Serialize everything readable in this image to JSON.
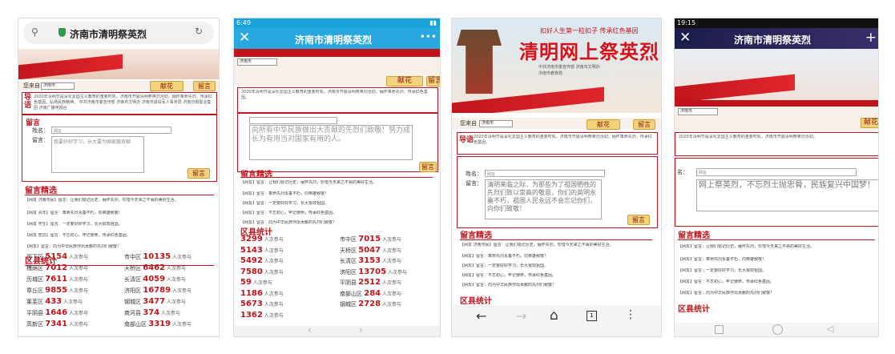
{
  "p1": {
    "address": "济南市清明祭英烈",
    "greeting": "您来自",
    "region_select": "济南市",
    "btn_offer": "献花",
    "btn_msg": "留言",
    "guide_title": "导语",
    "guide_text": "2020年清明节是深化爱国主义教育的重要时机，济南市开展清明祭英烈活动，缅怀革命先烈，传承红色基因，弘扬民族精神。",
    "guide_text2": "中共济南市委宣传部 济南市文明办 济南市退役军人事务局 济南日报报业集团 济南广播电视台",
    "msg_title": "留言",
    "name_label": "姓名：",
    "name_value": "网友",
    "msg_label": "留言：",
    "msg_placeholder": "我要好好学习，长大要为国家做贡献",
    "submit": "留言",
    "selected_title": "留言精选",
    "msgs": [
      "【网友 济南市民】留言：让我们铭记历史，缅怀先烈，珍惜今天来之不易的美好生活。",
      "【网友 青年】留言：革命先烈永垂不朽，向英雄致敬！",
      "【网友 学生】留言：一定要好好学习，长大报效祖国。",
      "【网友 党员】留言：不忘初心，牢记使命，传承红色基因。",
      "【网友】留言：向为中华民族作出贡献的先烈们致敬！"
    ],
    "stats_title": "区县统计",
    "unit": "人次参与",
    "stats": [
      {
        "name": "历下区",
        "n": "5154"
      },
      {
        "name": "市中区",
        "n": "10135"
      },
      {
        "name": "槐荫区",
        "n": "7012"
      },
      {
        "name": "天桥区",
        "n": "6462"
      },
      {
        "name": "历城区",
        "n": "7611"
      },
      {
        "name": "长清区",
        "n": "4059"
      },
      {
        "name": "章丘区",
        "n": "9855"
      },
      {
        "name": "济阳区",
        "n": "16789"
      },
      {
        "name": "莱芜区",
        "n": "433"
      },
      {
        "name": "钢城区",
        "n": "3477"
      },
      {
        "name": "平阴县",
        "n": "1646"
      },
      {
        "name": "商河县",
        "n": "374"
      },
      {
        "name": "高新区",
        "n": "7341"
      },
      {
        "name": "南部山区",
        "n": "3319"
      }
    ]
  },
  "p2": {
    "time": "6:49",
    "title": "济南市清明祭英烈",
    "region_select": "济南市",
    "btn_offer": "献花",
    "btn_msg": "留言",
    "guide_text": "2020年清明节是深化爱国主义教育的重要时机，济南市开展清明祭英烈活动，缅怀革命先烈，传承红色基因。",
    "msg_placeholder": "向所有中华民族做出大贡献的先烈们致敬！努力成长为有用当对国家有用的人。",
    "selected_title": "留言精选",
    "msgs": [
      "【网友】留言：让我们铭记历史，缅怀先烈，珍惜今天来之不易的美好生活。",
      "【网友】留言：革命先烈永垂不朽，向英雄致敬！",
      "【网友】留言：一定要好好学习，长大报效祖国。",
      "【网友】留言：不忘初心，牢记使命，传承红色基因。",
      "【网友】留言：向为中华民族作出贡献的先烈们致敬！"
    ],
    "stats_title": "区县统计",
    "unit": "人次参与",
    "stats": [
      {
        "name": "",
        "n": "3299"
      },
      {
        "name": "市中区",
        "n": "7015"
      },
      {
        "name": "",
        "n": "5143"
      },
      {
        "name": "天桥区",
        "n": "5047"
      },
      {
        "name": "",
        "n": "5492"
      },
      {
        "name": "长清区",
        "n": "3153"
      },
      {
        "name": "",
        "n": "7580"
      },
      {
        "name": "济阳区",
        "n": "13705"
      },
      {
        "name": "",
        "n": "59"
      },
      {
        "name": "平阴县",
        "n": "2512"
      },
      {
        "name": "",
        "n": "1186"
      },
      {
        "name": "南部山区",
        "n": "284"
      },
      {
        "name": "",
        "n": "5673"
      },
      {
        "name": "钢城区",
        "n": "2728"
      },
      {
        "name": "",
        "n": "1362"
      }
    ]
  },
  "p3": {
    "slogan": "扣好人生第一粒扣子 传承红色基因",
    "big_title": "清明网上祭英烈",
    "org1": "中共济南市委宣传部 济南市文明办",
    "org2": "济南市教育局",
    "greeting": "您来自",
    "region_select": "济南市",
    "btn_offer": "献花",
    "btn_msg": "留言",
    "guide_title": "导语",
    "guide_text": "2020年清明节是深化爱国主义教育的重要时机，济南市开展清明祭英烈活动，缅怀革命先烈，传承红色基因。",
    "msg_title": "留言",
    "name_label": "姓名：",
    "name_value": "网友",
    "msg_label": "留言：",
    "msg_text": "清明来临之际，为那些为了祖国牺牲的先烈们致以崇高的敬意，你们的英明永垂不朽，祖国人民永远不会忘记你们，向你们致敬！",
    "submit": "留言",
    "selected_title": "留言精选",
    "msgs": [
      "【网友 济南市民】留言：让我们铭记历史，缅怀先烈，珍惜今天来之不易的美好生活。",
      "【网友】留言：革命先烈永垂不朽，向英雄致敬！",
      "【网友】留言：一定要好好学习，长大报效祖国。",
      "【网友】留言：不忘初心，牢记使命，传承红色基因。",
      "【网友】留言：向为中华民族作出贡献的先烈们致敬！"
    ],
    "stats_title": "区县统计"
  },
  "p4": {
    "time": "19:15",
    "title": "济南市清明祭英烈",
    "region_select": "济南市",
    "btn_offer": "献花",
    "name_label": "名：",
    "name_value": "网友",
    "msg_text": "网上祭英烈，不忘烈士抛忠骨，民族复兴中国梦！",
    "selected_title": "留言精选",
    "msgs": [
      "【网友】留言：让我们铭记历史，缅怀先烈，珍惜今天来之不易的美好生活。",
      "【网友】留言：革命先烈永垂不朽，向英雄致敬！",
      "【网友】留言：一定要好好学习，长大报效祖国。",
      "【网友】留言：不忘初心，牢记使命，传承红色基因。",
      "【网友】留言：向为中华民族作出贡献的先烈们致敬！"
    ],
    "stats_title": "区县统计"
  }
}
